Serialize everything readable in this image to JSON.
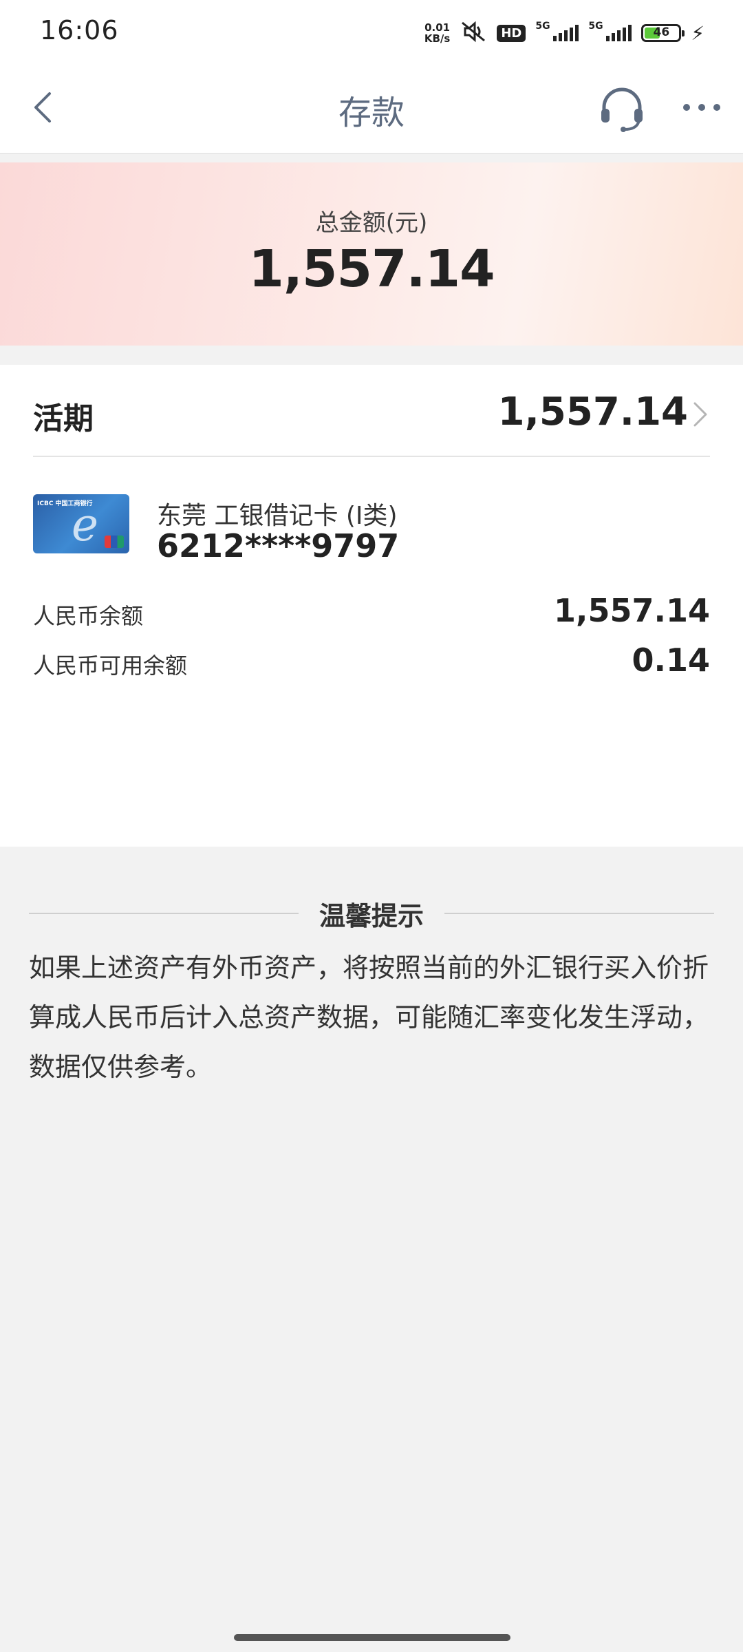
{
  "status_bar": {
    "time": "16:06",
    "net_speed_value": "0.01",
    "net_speed_unit": "KB/s",
    "hd_label": "HD",
    "signal1_label": "5G",
    "signal2_label": "5G",
    "battery_level": "46",
    "battery_fraction": 0.46
  },
  "nav": {
    "title": "存款"
  },
  "summary": {
    "label": "总金额(元)",
    "amount": "1,557.14"
  },
  "demand": {
    "title": "活期",
    "amount": "1,557.14",
    "account": {
      "name": "东莞 工银借记卡 (I类)",
      "number": "6212****9797",
      "card_brand_text": "ICBC 中国工商银行",
      "card_letter": "e"
    },
    "rows": [
      {
        "label": "人民币余额",
        "value": "1,557.14"
      },
      {
        "label": "人民币可用余额",
        "value": "0.14"
      }
    ]
  },
  "tips": {
    "title": "温馨提示",
    "body": "如果上述资产有外币资产，将按照当前的外汇银行买入价折算成人民币后计入总资产数据，可能随汇率变化发生浮动，数据仅供参考。"
  },
  "colors": {
    "nav_title": "#5d6b80",
    "hero_gradient_start": "#fbd9d8",
    "hero_gradient_end": "#fde4d7",
    "battery_fill": "#5cc93a",
    "page_bg": "#f2f2f2"
  },
  "icons": {
    "back": "back-arrow-icon",
    "service": "headset-icon",
    "more": "more-dots-icon",
    "chevron": "chevron-right-icon"
  }
}
